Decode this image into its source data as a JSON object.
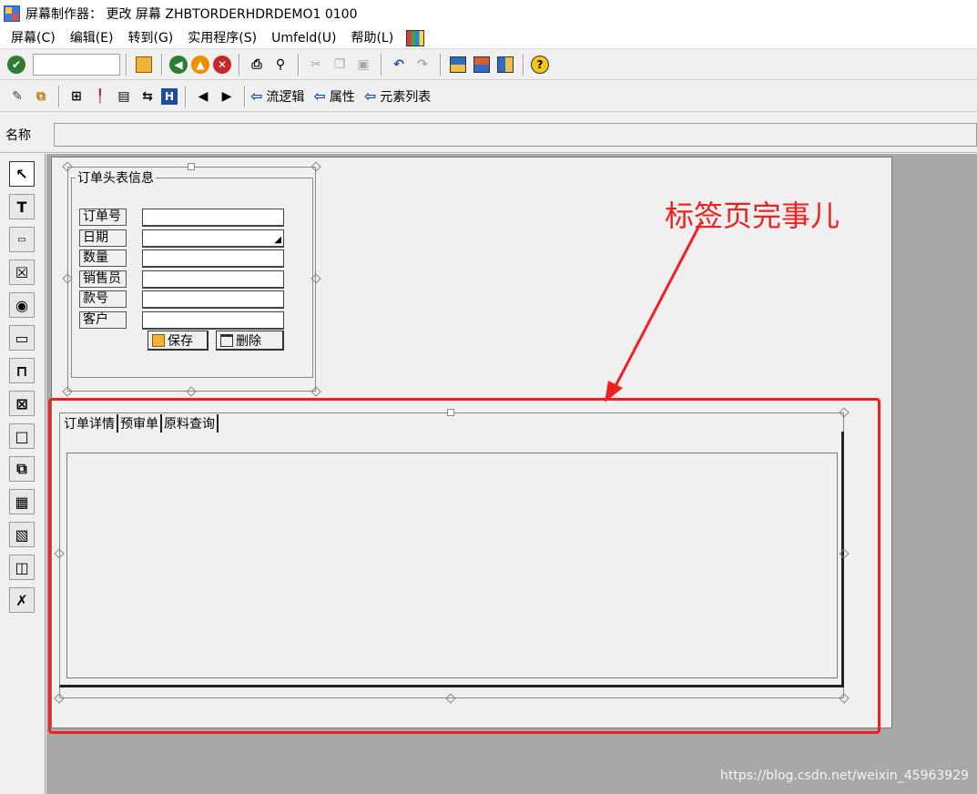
{
  "window": {
    "title": "屏幕制作器：  更改 屏幕 ZHBTORDERHDRDEMO1 0100"
  },
  "menu": {
    "items": [
      "屏幕(C)",
      "编辑(E)",
      "转到(G)",
      "实用程序(S)",
      "Umfeld(U)",
      "帮助(L)"
    ]
  },
  "toolbar2": {
    "flow_logic": "流逻辑",
    "attributes": "属性",
    "element_list": "元素列表"
  },
  "name_row": {
    "label": "名称",
    "value": ""
  },
  "frame": {
    "title": "订单头表信息",
    "fields": [
      {
        "label": "订单号",
        "value": ""
      },
      {
        "label": "日期",
        "value": ""
      },
      {
        "label": "数量",
        "value": ""
      },
      {
        "label": "销售员",
        "value": ""
      },
      {
        "label": "款号",
        "value": ""
      },
      {
        "label": "客户",
        "value": ""
      }
    ],
    "save_button": "保存",
    "delete_button": "删除"
  },
  "tabstrip": {
    "tabs": [
      "订单详情",
      "预审单",
      "原料查询"
    ]
  },
  "annotation": {
    "text": "标签页完事儿",
    "color": "#f02020"
  },
  "watermark": "https://blog.csdn.net/weixin_45963929"
}
